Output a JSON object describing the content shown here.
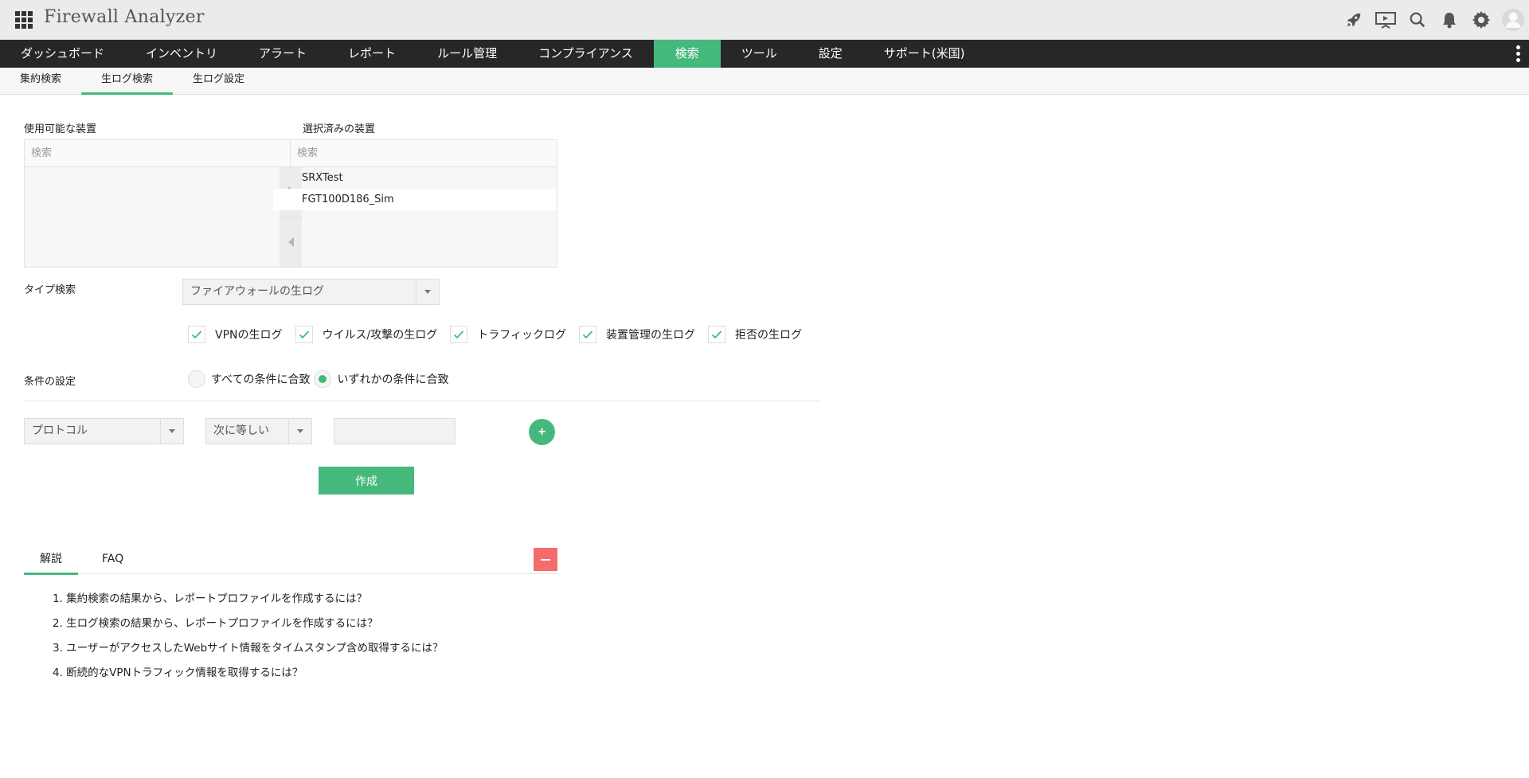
{
  "header": {
    "title": "Firewall Analyzer",
    "icons": [
      "rocket-icon",
      "presentation-icon",
      "search-icon",
      "bell-icon",
      "gear-icon",
      "user-avatar-icon"
    ]
  },
  "nav": {
    "items": [
      "ダッシュボード",
      "インベントリ",
      "アラート",
      "レポート",
      "ルール管理",
      "コンプライアンス",
      "検索",
      "ツール",
      "設定",
      "サポート(米国)"
    ],
    "active": "検索"
  },
  "subnav": {
    "items": [
      "集約検索",
      "生ログ検索",
      "生ログ設定"
    ],
    "active": "生ログ検索"
  },
  "devices": {
    "available_label": "使用可能な装置",
    "selected_label": "選択済みの装置",
    "available_search_placeholder": "検索",
    "selected_search_placeholder": "検索",
    "selected": [
      "SRXTest",
      "FGT100D186_Sim"
    ]
  },
  "type_search": {
    "label": "タイプ検索",
    "value": "ファイアウォールの生ログ",
    "checkboxes": [
      "VPNの生ログ",
      "ウイルス/攻撃の生ログ",
      "トラフィックログ",
      "装置管理の生ログ",
      "拒否の生ログ"
    ]
  },
  "conditions": {
    "label": "条件の設定",
    "options": [
      "すべての条件に合致",
      "いずれかの条件に合致"
    ],
    "selected_index": 1,
    "field_value": "プロトコル",
    "operator_value": "次に等しい",
    "value_input": "",
    "add_label": "+",
    "create_label": "作成"
  },
  "help": {
    "tabs": [
      "解説",
      "FAQ"
    ],
    "active": "解説",
    "items": [
      "1. 集約検索の結果から、レポートプロファイルを作成するには？",
      "2. 生ログ検索の結果から、レポートプロファイルを作成するには？",
      "3. ユーザーがアクセスしたWebサイト情報をタイムスタンプ含め取得するには？",
      "4. 断続的なVPNトラフィック情報を取得するには？"
    ]
  },
  "colors": {
    "accent": "#45b97c",
    "nav_bg": "#272727",
    "danger": "#f46c6c"
  }
}
